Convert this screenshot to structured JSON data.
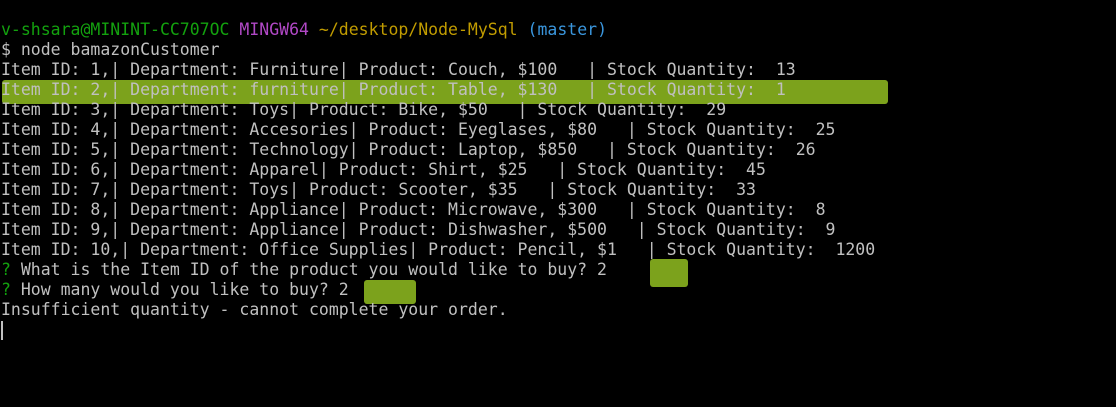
{
  "prompt": {
    "user": "v-shsara@MININT-CC707OC",
    "system": "MINGW64",
    "path": "~/desktop/Node-MySql",
    "branch": "(master)"
  },
  "command": "$ node bamazonCustomer",
  "items": [
    "Item ID: 1,| Department: Furniture| Product: Couch, $100   | Stock Quantity:  13",
    "Item ID: 2,| Department: furniture| Product: Table, $130   | Stock Quantity:  1",
    "Item ID: 3,| Department: Toys| Product: Bike, $50   | Stock Quantity:  29",
    "Item ID: 4,| Department: Accesories| Product: Eyeglases, $80   | Stock Quantity:  25",
    "Item ID: 5,| Department: Technology| Product: Laptop, $850   | Stock Quantity:  26",
    "Item ID: 6,| Department: Apparel| Product: Shirt, $25   | Stock Quantity:  45",
    "Item ID: 7,| Department: Toys| Product: Scooter, $35   | Stock Quantity:  33",
    "Item ID: 8,| Department: Appliance| Product: Microwave, $300   | Stock Quantity:  8",
    "Item ID: 9,| Department: Appliance| Product: Dishwasher, $500   | Stock Quantity:  9",
    "Item ID: 10,| Department: Office Supplies| Product: Pencil, $1   | Stock Quantity:  1200"
  ],
  "questions": [
    {
      "mark": "?",
      "text": " What is the Item ID of the product you would like to buy? ",
      "answer": "2"
    },
    {
      "mark": "?",
      "text": " How many would you like to buy? ",
      "answer": "2"
    }
  ],
  "result": "Insufficient quantity - cannot complete your order.",
  "colors": {
    "background": "#000000",
    "text": "#c0c0c0",
    "user": "#13a10e",
    "system": "#b148c6",
    "path": "#c19c00",
    "branch": "#3a96dd",
    "highlight": "#8ab41f"
  }
}
